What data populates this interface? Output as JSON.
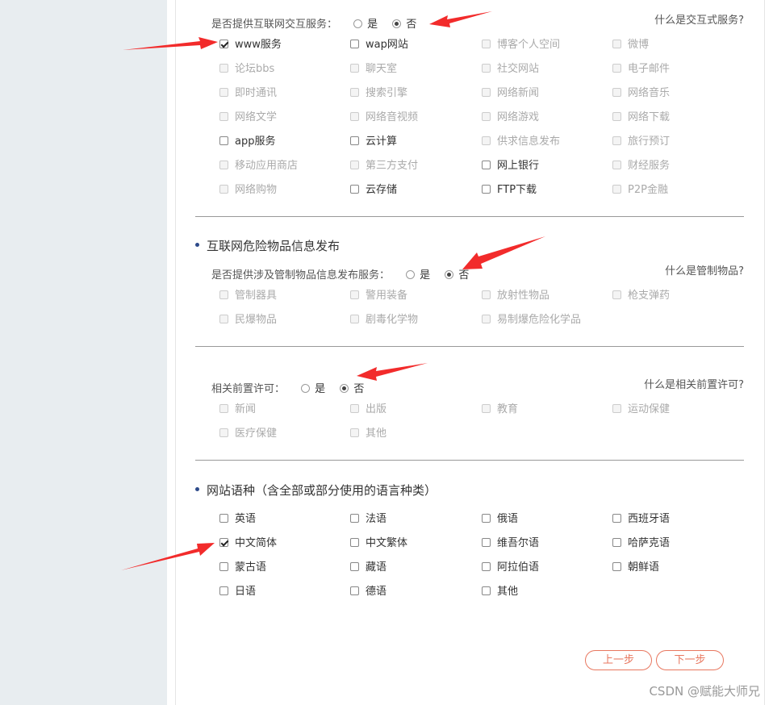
{
  "section1": {
    "question": "是否提供互联网交互服务：",
    "yes": "是",
    "no": "否",
    "help": "什么是交互式服务?",
    "items": [
      {
        "label": "www服务",
        "checked": true,
        "disabled": false
      },
      {
        "label": "wap网站",
        "checked": false,
        "disabled": false
      },
      {
        "label": "博客个人空间",
        "checked": false,
        "disabled": true
      },
      {
        "label": "微博",
        "checked": false,
        "disabled": true
      },
      {
        "label": "论坛bbs",
        "checked": false,
        "disabled": true
      },
      {
        "label": "聊天室",
        "checked": false,
        "disabled": true
      },
      {
        "label": "社交网站",
        "checked": false,
        "disabled": true
      },
      {
        "label": "电子邮件",
        "checked": false,
        "disabled": true
      },
      {
        "label": "即时通讯",
        "checked": false,
        "disabled": true
      },
      {
        "label": "搜索引擎",
        "checked": false,
        "disabled": true
      },
      {
        "label": "网络新闻",
        "checked": false,
        "disabled": true
      },
      {
        "label": "网络音乐",
        "checked": false,
        "disabled": true
      },
      {
        "label": "网络文学",
        "checked": false,
        "disabled": true
      },
      {
        "label": "网络音视频",
        "checked": false,
        "disabled": true
      },
      {
        "label": "网络游戏",
        "checked": false,
        "disabled": true
      },
      {
        "label": "网络下载",
        "checked": false,
        "disabled": true
      },
      {
        "label": "app服务",
        "checked": false,
        "disabled": false
      },
      {
        "label": "云计算",
        "checked": false,
        "disabled": false
      },
      {
        "label": "供求信息发布",
        "checked": false,
        "disabled": true
      },
      {
        "label": "旅行预订",
        "checked": false,
        "disabled": true
      },
      {
        "label": "移动应用商店",
        "checked": false,
        "disabled": true
      },
      {
        "label": "第三方支付",
        "checked": false,
        "disabled": true
      },
      {
        "label": "网上银行",
        "checked": false,
        "disabled": false
      },
      {
        "label": "财经服务",
        "checked": false,
        "disabled": true
      },
      {
        "label": "网络购物",
        "checked": false,
        "disabled": true
      },
      {
        "label": "云存储",
        "checked": false,
        "disabled": false
      },
      {
        "label": "FTP下载",
        "checked": false,
        "disabled": false
      },
      {
        "label": "P2P金融",
        "checked": false,
        "disabled": true
      }
    ]
  },
  "section2": {
    "title": "互联网危险物品信息发布",
    "question": "是否提供涉及管制物品信息发布服务：",
    "yes": "是",
    "no": "否",
    "help": "什么是管制物品?",
    "items": [
      {
        "label": "管制器具",
        "checked": false,
        "disabled": true
      },
      {
        "label": "警用装备",
        "checked": false,
        "disabled": true
      },
      {
        "label": "放射性物品",
        "checked": false,
        "disabled": true
      },
      {
        "label": "枪支弹药",
        "checked": false,
        "disabled": true
      },
      {
        "label": "民爆物品",
        "checked": false,
        "disabled": true
      },
      {
        "label": "剧毒化学物",
        "checked": false,
        "disabled": true
      },
      {
        "label": "易制爆危险化学品",
        "checked": false,
        "disabled": true
      }
    ]
  },
  "section3": {
    "question": "相关前置许可：",
    "yes": "是",
    "no": "否",
    "help": "什么是相关前置许可?",
    "items": [
      {
        "label": "新闻",
        "checked": false,
        "disabled": true
      },
      {
        "label": "出版",
        "checked": false,
        "disabled": true
      },
      {
        "label": "教育",
        "checked": false,
        "disabled": true
      },
      {
        "label": "运动保健",
        "checked": false,
        "disabled": true
      },
      {
        "label": "医疗保健",
        "checked": false,
        "disabled": true
      },
      {
        "label": "其他",
        "checked": false,
        "disabled": true
      }
    ]
  },
  "section4": {
    "title": "网站语种（含全部或部分使用的语言种类）",
    "items": [
      {
        "label": "英语",
        "checked": false,
        "disabled": false
      },
      {
        "label": "法语",
        "checked": false,
        "disabled": false
      },
      {
        "label": "俄语",
        "checked": false,
        "disabled": false
      },
      {
        "label": "西班牙语",
        "checked": false,
        "disabled": false
      },
      {
        "label": "中文简体",
        "checked": true,
        "disabled": false
      },
      {
        "label": "中文繁体",
        "checked": false,
        "disabled": false
      },
      {
        "label": "维吾尔语",
        "checked": false,
        "disabled": false
      },
      {
        "label": "哈萨克语",
        "checked": false,
        "disabled": false
      },
      {
        "label": "蒙古语",
        "checked": false,
        "disabled": false
      },
      {
        "label": "藏语",
        "checked": false,
        "disabled": false
      },
      {
        "label": "阿拉伯语",
        "checked": false,
        "disabled": false
      },
      {
        "label": "朝鲜语",
        "checked": false,
        "disabled": false
      },
      {
        "label": "日语",
        "checked": false,
        "disabled": false
      },
      {
        "label": "德语",
        "checked": false,
        "disabled": false
      },
      {
        "label": "其他",
        "checked": false,
        "disabled": false
      }
    ]
  },
  "buttons": {
    "prev": "上一步",
    "next": "下一步"
  },
  "watermark": "CSDN @赋能大师兄",
  "colors": {
    "accent": "#e8775f",
    "bullet": "#2d4a8a",
    "arrow": "#f22b2b",
    "sidebar": "#e8edf0"
  }
}
